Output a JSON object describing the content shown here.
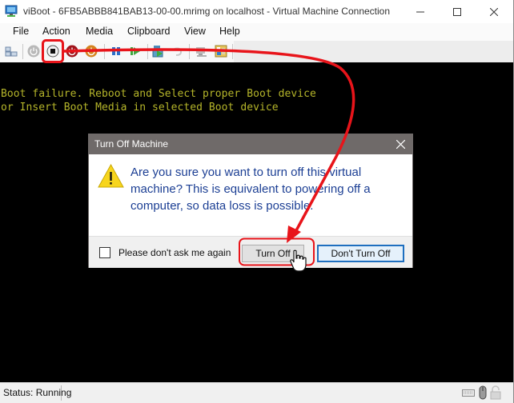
{
  "window": {
    "title": "viBoot - 6FB5ABBB841BAB13-00-00.mrimg on localhost - Virtual Machine Connection",
    "app_icon": "vm-connection-icon",
    "controls": [
      "minimize-icon",
      "maximize-icon",
      "close-icon"
    ]
  },
  "menubar": {
    "items": [
      {
        "label": "File"
      },
      {
        "label": "Action"
      },
      {
        "label": "Media"
      },
      {
        "label": "Clipboard"
      },
      {
        "label": "View"
      },
      {
        "label": "Help"
      }
    ]
  },
  "toolbar": {
    "items": [
      {
        "icon": "ctrl-alt-del-icon",
        "enabled": true
      },
      {
        "icon": "start-icon",
        "enabled": false
      },
      {
        "icon": "turn-off-icon",
        "enabled": true,
        "highlighted": true
      },
      {
        "icon": "shut-down-icon",
        "enabled": true
      },
      {
        "icon": "save-icon",
        "enabled": true
      },
      {
        "icon": "pause-icon",
        "enabled": true
      },
      {
        "icon": "reset-icon",
        "enabled": true
      },
      {
        "icon": "checkpoint-icon",
        "enabled": true
      },
      {
        "icon": "revert-icon",
        "enabled": false
      },
      {
        "icon": "enhanced-session-icon",
        "enabled": false
      },
      {
        "icon": "share-icon",
        "enabled": true
      }
    ]
  },
  "console": {
    "lines": [
      "Boot failure. Reboot and Select proper Boot device",
      "or Insert Boot Media in selected Boot device"
    ],
    "text_color": "#b5b52a"
  },
  "dialog": {
    "title": "Turn Off Machine",
    "message": "Are you sure you want to turn off this virtual machine? This is equivalent to powering off a computer, so data loss is possible.",
    "icon": "warning-icon",
    "checkbox_label": "Please don't ask me again",
    "checkbox_checked": false,
    "buttons": {
      "confirm": "Turn Off",
      "cancel": "Don't Turn Off"
    },
    "default_button": "cancel"
  },
  "annotation": {
    "color": "#e8141a",
    "description": "Red arrow from Turn Off toolbar button to Turn Off dialog button"
  },
  "statusbar": {
    "status": "Status: Running",
    "icons": [
      "keyboard-icon",
      "mouse-icon",
      "lock-icon"
    ]
  }
}
